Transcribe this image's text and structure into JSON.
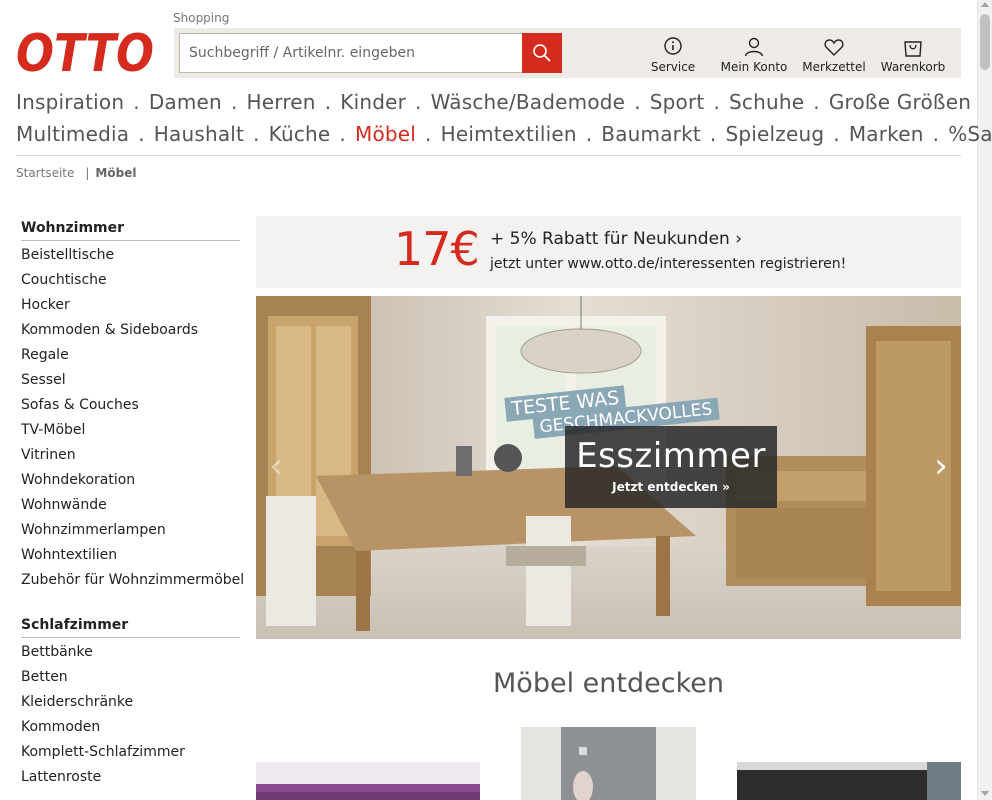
{
  "header": {
    "logo_text": "OTTO",
    "shopping_label": "Shopping",
    "search_placeholder": "Suchbegriff / Artikelnr. eingeben",
    "items": [
      {
        "label": "Service",
        "icon": "info-icon"
      },
      {
        "label": "Mein Konto",
        "icon": "user-icon"
      },
      {
        "label": "Merkzettel",
        "icon": "heart-icon"
      },
      {
        "label": "Warenkorb",
        "icon": "shopping-bag-icon"
      }
    ]
  },
  "nav": {
    "line1": [
      "Inspiration",
      "Damen",
      "Herren",
      "Kinder",
      "Wäsche/Bademode",
      "Sport",
      "Schuhe",
      "Große Größen"
    ],
    "line2": [
      "Multimedia",
      "Haushalt",
      "Küche",
      "Möbel",
      "Heimtextilien",
      "Baumarkt",
      "Spielzeug",
      "Marken",
      "%Sale%"
    ],
    "active": "Möbel",
    "separator": "."
  },
  "breadcrumb": {
    "home": "Startseite",
    "separator": "|",
    "current": "Möbel"
  },
  "sidebar": {
    "sections": [
      {
        "heading": "Wohnzimmer",
        "links": [
          "Beistelltische",
          "Couchtische",
          "Hocker",
          "Kommoden & Sideboards",
          "Regale",
          "Sessel",
          "Sofas & Couches",
          "TV-Möbel",
          "Vitrinen",
          "Wohndekoration",
          "Wohnwände",
          "Wohnzimmerlampen",
          "Wohntextilien",
          "Zubehör für Wohnzimmermöbel"
        ]
      },
      {
        "heading": "Schlafzimmer",
        "links": [
          "Bettbänke",
          "Betten",
          "Kleiderschränke",
          "Kommoden",
          "Komplett-Schlafzimmer",
          "Lattenroste"
        ]
      }
    ]
  },
  "promo": {
    "price": "17€",
    "title": "+ 5% Rabatt für Neukunden ›",
    "subtitle": "jetzt unter www.otto.de/interessenten registrieren!"
  },
  "hero": {
    "sticker_line1": "TESTE WAS",
    "sticker_line2": "GESCHMACKVOLLES",
    "title": "Esszimmer",
    "cta": "Jetzt entdecken »",
    "arrow_left": "‹",
    "arrow_right": "›"
  },
  "discover": {
    "title": "Möbel entdecken"
  },
  "colors": {
    "brand_red": "#d52b1e",
    "header_bar": "#eeebe7",
    "promo_bg": "#f3f2f0"
  }
}
